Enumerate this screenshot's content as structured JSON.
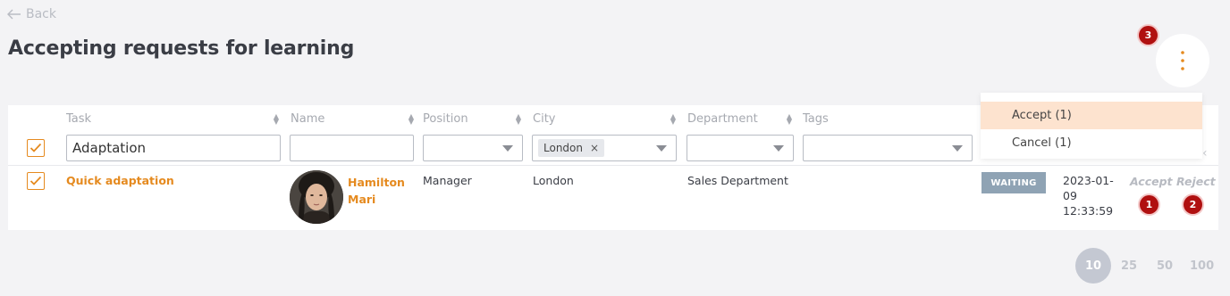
{
  "header": {
    "back_label": "Back",
    "title": "Accepting requests for learning"
  },
  "menu": {
    "badge": "3",
    "items": [
      {
        "label": "Accept (1)"
      },
      {
        "label": "Cancel (1)"
      }
    ]
  },
  "table": {
    "columns": {
      "task": "Task",
      "name": "Name",
      "position": "Position",
      "city": "City",
      "department": "Department",
      "tags": "Tags"
    },
    "filters": {
      "task_value": "Adaptation",
      "name_value": "",
      "position_value": "",
      "city_chip": "London",
      "department_value": "",
      "tags_value": ""
    },
    "rows": [
      {
        "task": "Quick adaptation",
        "name_line1": "Hamilton",
        "name_line2": "Mari",
        "position": "Manager",
        "city": "London",
        "department": "Sales Department",
        "status": "WAITING",
        "date_line1": "2023-01-",
        "date_line2": "09",
        "date_line3": "12:33:59",
        "accept_label": "Accept",
        "reject_label": "Reject",
        "accept_badge": "1",
        "reject_badge": "2"
      }
    ]
  },
  "pagination": {
    "active": "10",
    "options": [
      "25",
      "50",
      "100"
    ]
  },
  "colors": {
    "accent": "#e58a1f",
    "badge": "#b01010",
    "status_waiting": "#8fa3b4",
    "menu_highlight": "#fde3cf"
  }
}
